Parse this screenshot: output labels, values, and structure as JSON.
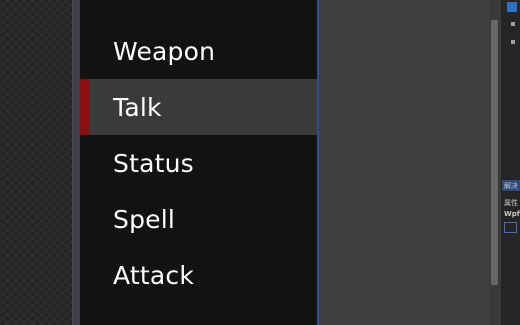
{
  "menu": {
    "items": [
      {
        "label": "Weapon",
        "selected": false
      },
      {
        "label": "Talk",
        "selected": true
      },
      {
        "label": "Status",
        "selected": false
      },
      {
        "label": "Spell",
        "selected": false
      },
      {
        "label": "Attack",
        "selected": false
      }
    ]
  },
  "right_panel": {
    "title": "解决",
    "property_label": "属性",
    "type_label": "Wpf"
  },
  "colors": {
    "selection_marker": "#8e0d0d",
    "selection_background": "#3a3a3a",
    "panel_background": "#121212",
    "content_background": "#3e3e3e"
  }
}
